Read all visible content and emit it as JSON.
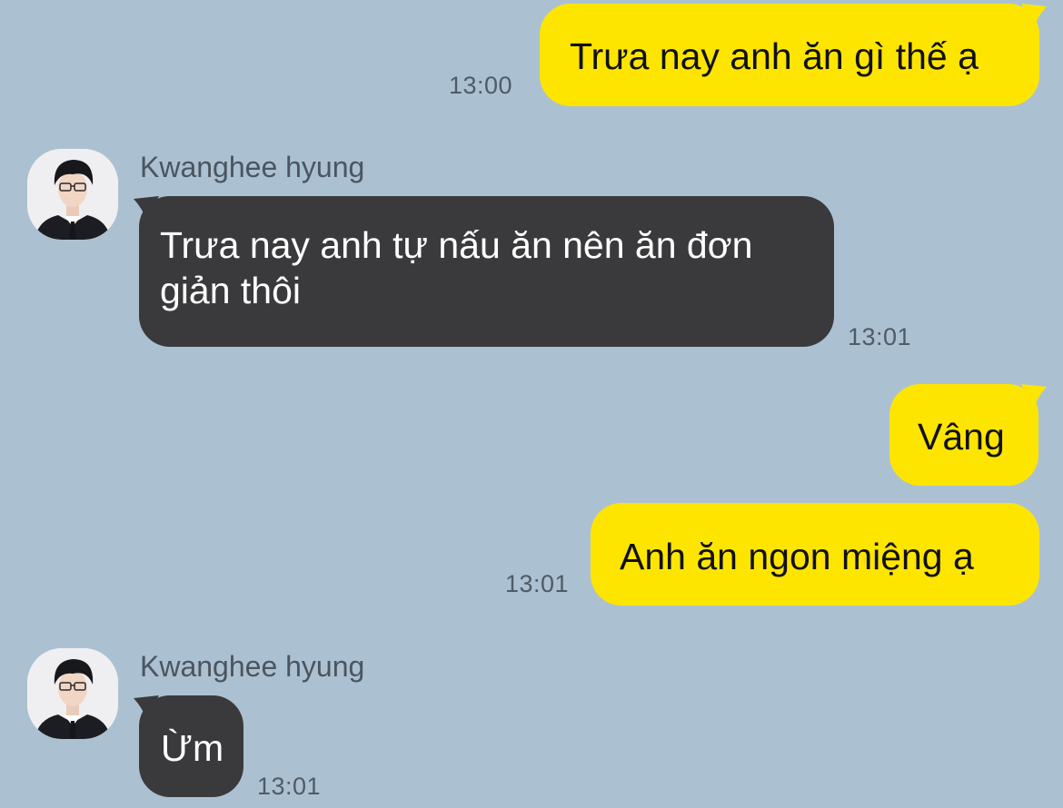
{
  "chat": {
    "messages": [
      {
        "side": "sent",
        "text": "Trưa nay anh ăn gì thế ạ",
        "time": "13:00"
      },
      {
        "side": "received",
        "sender": "Kwanghee hyung",
        "text_line1": "Trưa nay anh tự nấu ăn nên ăn đơn",
        "text_line2": "giản thôi",
        "time": "13:01"
      },
      {
        "side": "sent",
        "text": "Vâng"
      },
      {
        "side": "sent",
        "text": "Anh ăn ngon miệng ạ",
        "time": "13:01"
      },
      {
        "side": "received",
        "sender": "Kwanghee hyung",
        "text": "Ừm",
        "time": "13:01"
      }
    ]
  },
  "colors": {
    "background": "#abc1d1",
    "sent_bubble": "#fee500",
    "received_bubble": "#3a3a3c",
    "timestamp": "#4f5b66"
  },
  "icons": {
    "avatar": "profile-photo"
  }
}
